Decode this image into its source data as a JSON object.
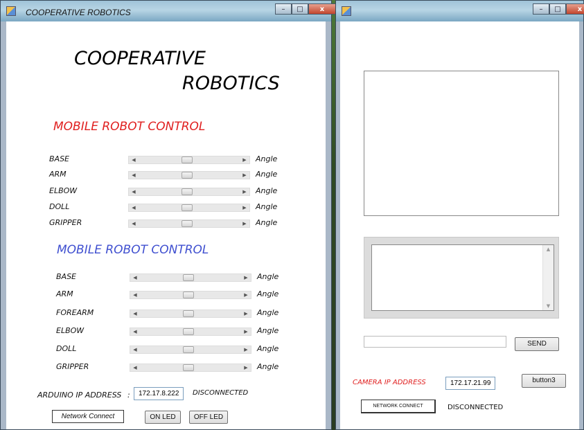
{
  "left_window": {
    "title": "COOPERATIVE ROBOTICS",
    "minimize": "–",
    "maximize": "□",
    "close": "x",
    "heading_line1": "COOPERATIVE",
    "heading_line2": "ROBOTICS",
    "section1": {
      "title": "MOBILE ROBOT CONTROL",
      "rows": [
        {
          "label": "BASE",
          "angle": "Angle"
        },
        {
          "label": "ARM",
          "angle": "Angle"
        },
        {
          "label": "ELBOW",
          "angle": "Angle"
        },
        {
          "label": "DOLL",
          "angle": "Angle"
        },
        {
          "label": "GRIPPER",
          "angle": "Angle"
        }
      ]
    },
    "section2": {
      "title": "MOBILE ROBOT CONTROL",
      "rows": [
        {
          "label": "BASE",
          "angle": "Angle"
        },
        {
          "label": "ARM",
          "angle": "Angle"
        },
        {
          "label": "FOREARM",
          "angle": "Angle"
        },
        {
          "label": "ELBOW",
          "angle": "Angle"
        },
        {
          "label": "DOLL",
          "angle": "Angle"
        },
        {
          "label": "GRIPPER",
          "angle": "Angle"
        }
      ]
    },
    "arduino_ip_label": "ARDUINO IP ADDRESS",
    "arduino_ip_value": "172.17.8.222",
    "arduino_status": "DISCONNECTED",
    "network_connect_label": "Network Connect",
    "on_led_label": "ON LED",
    "off_led_label": "OFF LED"
  },
  "right_window": {
    "minimize": "–",
    "maximize": "□",
    "close": "x",
    "send_label": "SEND",
    "camera_ip_label": "CAMERA IP ADDRESS",
    "camera_ip_value": "172.17.21.99",
    "button3_label": "button3",
    "network_connect_label": "NETWORK CONNECT",
    "status": "DISCONNECTED"
  }
}
